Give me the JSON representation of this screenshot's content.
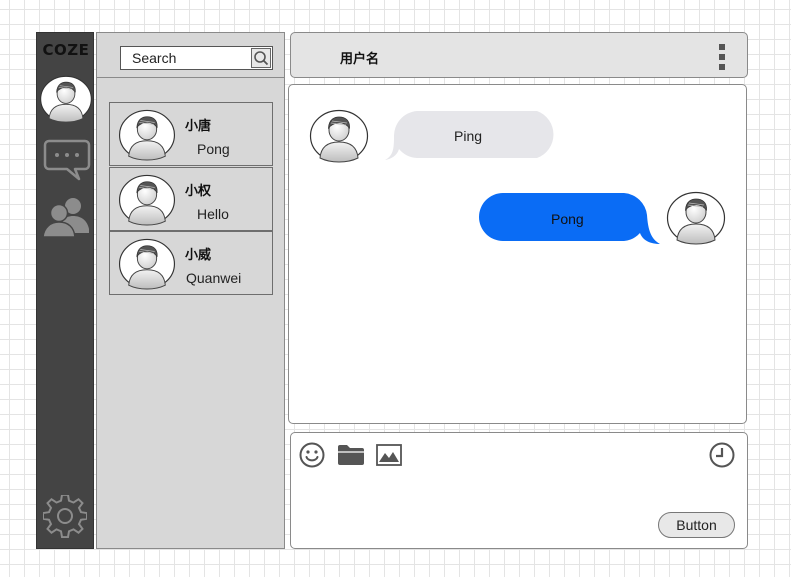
{
  "sidebar": {
    "brand": "COZE",
    "nav_icons": [
      "avatar",
      "chat-bubble-icon",
      "contacts-icon",
      "gear-icon"
    ]
  },
  "search": {
    "placeholder": "Search",
    "icon": "search-icon"
  },
  "contacts": [
    {
      "name": "小唐",
      "last_message": "Pong"
    },
    {
      "name": "小权",
      "last_message": "Hello"
    },
    {
      "name": "小威",
      "last_message": "Quanwei"
    }
  ],
  "chat": {
    "username": "用户名",
    "menu_icon": "more-vertical-icon",
    "messages": [
      {
        "side": "left",
        "text": "Ping",
        "bubble_color": "#e6e6ea"
      },
      {
        "side": "right",
        "text": "Pong",
        "bubble_color": "#0a6cf5"
      }
    ]
  },
  "composer": {
    "tool_icons": [
      "emoji-icon",
      "folder-icon",
      "image-icon",
      "clock-icon"
    ],
    "send_label": "Button"
  },
  "colors": {
    "rail": "#444444",
    "panel": "#d7d7d7",
    "accent": "#0a6cf5"
  }
}
